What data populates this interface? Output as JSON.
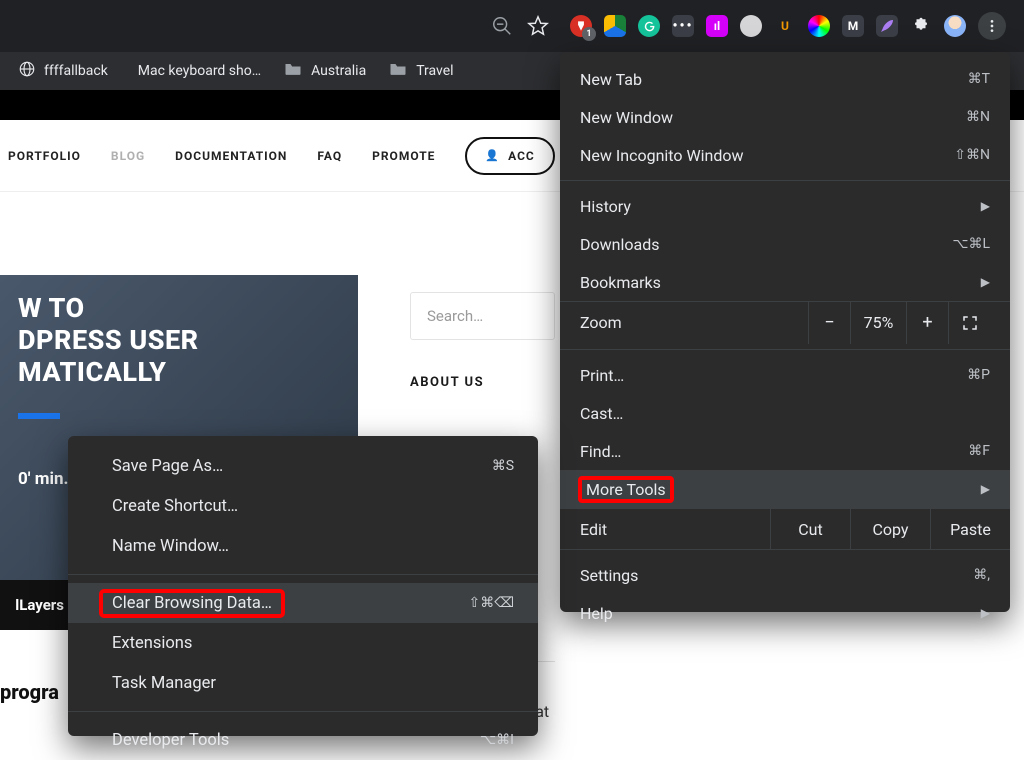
{
  "toolbar": {
    "adblock_badge": "1",
    "lastpass_glyph": "•••",
    "magenta_glyph": "ıl",
    "ubersuggest_glyph": "U",
    "gmail_glyph": "M"
  },
  "bookmarks": {
    "items": [
      {
        "label": "ffffallback"
      },
      {
        "label": "Mac keyboard sho…"
      },
      {
        "label": "Australia"
      },
      {
        "label": "Travel"
      }
    ]
  },
  "site_nav": {
    "items": [
      {
        "label": "PORTFOLIO"
      },
      {
        "label": "BLOG"
      },
      {
        "label": "DOCUMENTATION"
      },
      {
        "label": "FAQ"
      },
      {
        "label": "PROMOTE"
      }
    ],
    "account_label": "ACC"
  },
  "hero": {
    "title_l1": "W TO",
    "title_l2": "DPRESS USER",
    "title_l3": "MATICALLY",
    "minutes": "0' min.",
    "tab_label": "lLayers",
    "prog_label": "progra"
  },
  "sidebar": {
    "search_placeholder": "Search…",
    "about_label": "ABOUT US",
    "chat_label": "Chat"
  },
  "main_menu": {
    "new_tab": "New Tab",
    "new_tab_short": "⌘T",
    "new_window": "New Window",
    "new_window_short": "⌘N",
    "incognito": "New Incognito Window",
    "incognito_short": "⇧⌘N",
    "history": "History",
    "downloads": "Downloads",
    "downloads_short": "⌥⌘L",
    "bookmarks": "Bookmarks",
    "zoom_label": "Zoom",
    "zoom_pct": "75%",
    "print": "Print…",
    "print_short": "⌘P",
    "cast": "Cast…",
    "find": "Find…",
    "find_short": "⌘F",
    "more_tools": "More Tools",
    "edit": "Edit",
    "cut": "Cut",
    "copy": "Copy",
    "paste": "Paste",
    "settings": "Settings",
    "settings_short": "⌘,",
    "help": "Help"
  },
  "sub_menu": {
    "save_as": "Save Page As…",
    "save_as_short": "⌘S",
    "create_shortcut": "Create Shortcut…",
    "name_window": "Name Window…",
    "clear_data": "Clear Browsing Data…",
    "clear_data_short": "⇧⌘⌫",
    "extensions": "Extensions",
    "task_manager": "Task Manager",
    "developer_tools": "Developer Tools",
    "developer_tools_short": "⌥⌘I"
  }
}
